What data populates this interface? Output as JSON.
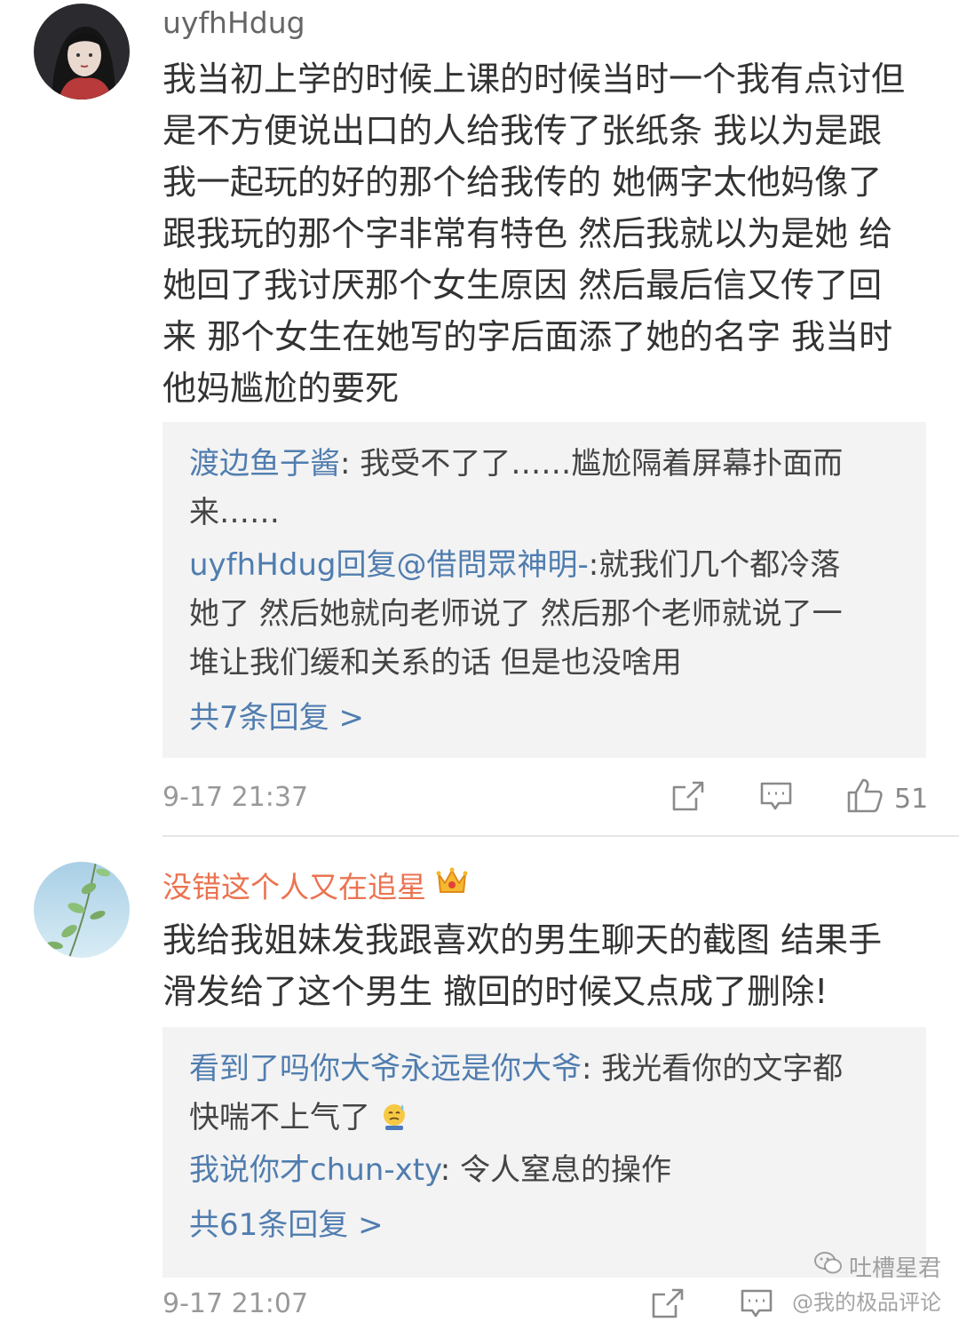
{
  "comments": [
    {
      "username": "uyfhHdug",
      "body_lines": [
        "我当初上学的时候上课的时候当时一个我有点讨但",
        "是不方便说出口的人给我传了张纸条 我以为是跟",
        "我一起玩的好的那个给我传的  她俩字太他妈像了",
        "跟我玩的那个字非常有特色 然后我就以为是她 给",
        "她回了我讨厌那个女生原因 然后最后信又传了回",
        "来 那个女生在她写的字后面添了她的名字 我当时",
        "他妈尴尬的要死"
      ],
      "replies": [
        {
          "author": "渡边鱼子酱",
          "sep": ": ",
          "line1": "我受不了了……尴尬隔着屏幕扑面而",
          "line2": "来……"
        },
        {
          "author": "uyfhHdug回复@借問眾神明-",
          "sep": ":",
          "line1": "就我们几个都冷落",
          "line2": "她了 然后她就向老师说了  然后那个老师就说了一",
          "line3": "堆让我们缓和关系的话 但是也没啥用"
        }
      ],
      "more_replies": "共7条回复 >",
      "timestamp": "9-17 21:37",
      "likes": "51"
    },
    {
      "username": "没错这个人又在追星",
      "body_lines": [
        "我给我姐妹发我跟喜欢的男生聊天的截图 结果手",
        "滑发给了这个男生 撤回的时候又点成了删除!"
      ],
      "replies": [
        {
          "author": "看到了吗你大爷永远是你大爷",
          "sep": ": ",
          "line1": "我光看你的文字都",
          "line2": "快喘不上气了"
        },
        {
          "author": "我说你才chun-xty",
          "sep": ": ",
          "line1": "令人窒息的操作"
        }
      ],
      "more_replies": "共61条回复 >",
      "timestamp": "9-17 21:07"
    }
  ],
  "watermark": {
    "line1": "吐槽星君",
    "line2": "@我的极品评论"
  },
  "colors": {
    "link_blue": "#507daf",
    "vip_orange": "#eb7350",
    "reply_bg": "#f3f3f3"
  },
  "icons": [
    "share-icon",
    "comment-icon",
    "like-icon",
    "crown-icon",
    "wechat-icon"
  ]
}
